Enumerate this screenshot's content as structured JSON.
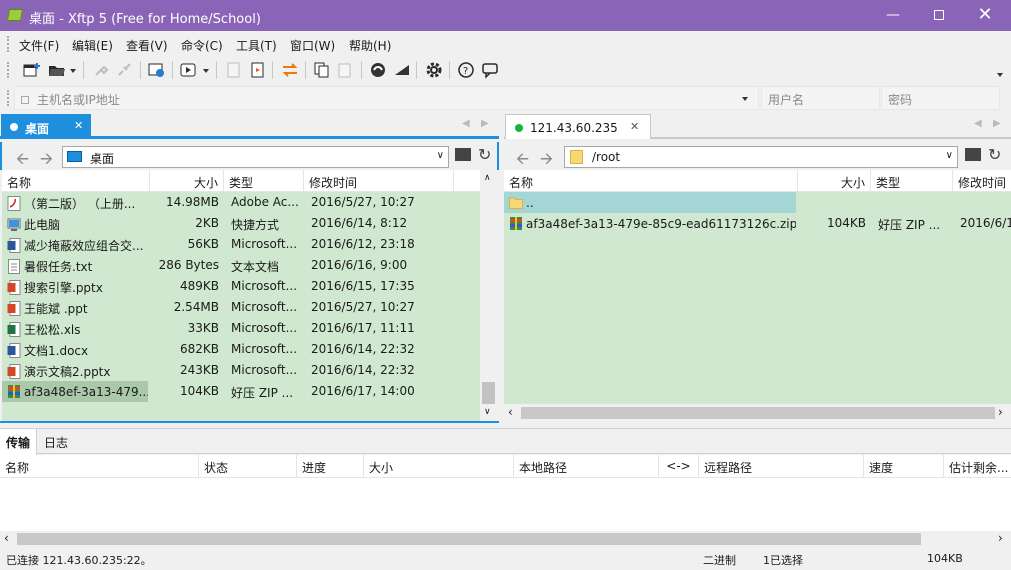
{
  "window": {
    "title": "桌面 - Xftp 5 (Free for Home/School)"
  },
  "menu": [
    "文件(F)",
    "编辑(E)",
    "查看(V)",
    "命令(C)",
    "工具(T)",
    "窗口(W)",
    "帮助(H)"
  ],
  "address": {
    "host_placeholder": "主机名或IP地址",
    "user_placeholder": "用户名",
    "password_placeholder": "密码"
  },
  "left_pane": {
    "tab_label": "桌面",
    "path": "桌面",
    "columns": [
      "名称",
      "大小",
      "类型",
      "修改时间"
    ],
    "rows": [
      {
        "name": "（第二版）  （上册...",
        "size": "14.98MB",
        "type": "Adobe Ac...",
        "modified": "2016/5/27, 10:27",
        "icon": "pdf-icon"
      },
      {
        "name": "此电脑",
        "size": "2KB",
        "type": "快捷方式",
        "modified": "2016/6/14, 8:12",
        "icon": "shortcut-icon"
      },
      {
        "name": "减少掩蔽效应组合交...",
        "size": "56KB",
        "type": "Microsoft...",
        "modified": "2016/6/12, 23:18",
        "icon": "word-icon"
      },
      {
        "name": "暑假任务.txt",
        "size": "286 Bytes",
        "type": "文本文档",
        "modified": "2016/6/16, 9:00",
        "icon": "txt-icon"
      },
      {
        "name": "搜索引擎.pptx",
        "size": "489KB",
        "type": "Microsoft...",
        "modified": "2016/6/15, 17:35",
        "icon": "ppt-icon"
      },
      {
        "name": "王能斌 .ppt",
        "size": "2.54MB",
        "type": "Microsoft...",
        "modified": "2016/5/27, 10:27",
        "icon": "ppt-icon"
      },
      {
        "name": "王松松.xls",
        "size": "33KB",
        "type": "Microsoft...",
        "modified": "2016/6/17, 11:11",
        "icon": "excel-icon"
      },
      {
        "name": "文档1.docx",
        "size": "682KB",
        "type": "Microsoft...",
        "modified": "2016/6/14, 22:32",
        "icon": "word-icon"
      },
      {
        "name": "演示文稿2.pptx",
        "size": "243KB",
        "type": "Microsoft...",
        "modified": "2016/6/14, 22:32",
        "icon": "ppt-icon"
      },
      {
        "name": "af3a48ef-3a13-479...",
        "size": "104KB",
        "type": "好压 ZIP ...",
        "modified": "2016/6/17, 14:00",
        "icon": "zip-icon",
        "selected": true
      }
    ]
  },
  "right_pane": {
    "tab_label": "121.43.60.235",
    "path": "/root",
    "columns": [
      "名称",
      "大小",
      "类型",
      "修改时间"
    ],
    "rows": [
      {
        "name": "..",
        "size": "",
        "type": "",
        "modified": "",
        "icon": "folder-icon",
        "selected": true
      },
      {
        "name": "af3a48ef-3a13-479e-85c9-ead61173126c.zip",
        "size": "104KB",
        "type": "好压 ZIP ...",
        "modified": "2016/6/1",
        "icon": "zip-icon"
      }
    ]
  },
  "bottom": {
    "tabs": [
      "传输",
      "日志"
    ],
    "columns": [
      "名称",
      "状态",
      "进度",
      "大小",
      "本地路径",
      "<->",
      "远程路径",
      "速度",
      "估计剩余..."
    ]
  },
  "status": {
    "connection": "已连接 121.43.60.235:22。",
    "mode": "二进制",
    "selection": "1已选择",
    "size": "104KB"
  },
  "colors": {
    "titlebar": "#8a64b7",
    "active_tab": "#1e8fdc",
    "list_bg": "#cfe8cf",
    "connected_dot": "#18b33a"
  }
}
